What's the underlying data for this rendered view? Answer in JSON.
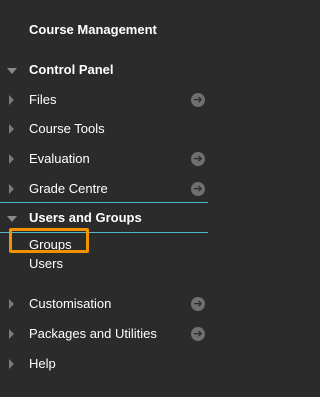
{
  "menu": {
    "header": "Course Management",
    "control_panel": "Control Panel",
    "files": "Files",
    "course_tools": "Course Tools",
    "evaluation": "Evaluation",
    "grade_centre": "Grade Centre",
    "users_and_groups": "Users and Groups",
    "groups": "Groups",
    "users": "Users",
    "customisation": "Customisation",
    "packages_and_utilities": "Packages and Utilities",
    "help": "Help"
  },
  "icons": {
    "expand_collapse": "triangle-icon",
    "go_arrow": "arrow-right-circle-icon"
  },
  "colors": {
    "background": "#2b2b2b",
    "divider": "#4fb7c8",
    "highlight": "#f39200"
  }
}
